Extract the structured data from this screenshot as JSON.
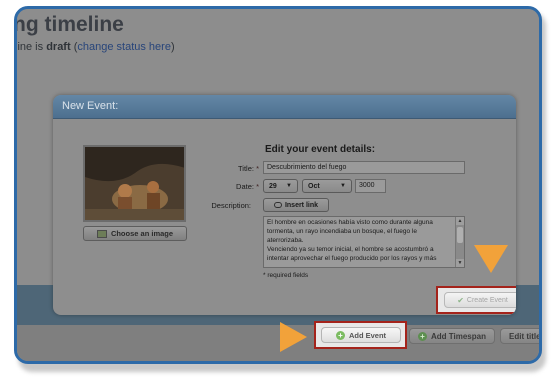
{
  "background": {
    "title": "ng timeline",
    "status_prefix": "line is ",
    "status_value": "draft",
    "status_link": "change status here",
    "toolbar": {
      "add_timespan_label": "Add Timespan",
      "edit_title_label": "Edit title"
    }
  },
  "modal": {
    "title": "New Event:",
    "heading": "Edit your event details:",
    "choose_image_label": "Choose an image",
    "title_label": "Title:",
    "title_value": "Descubrimiento del fuego",
    "date_label": "Date:",
    "day_value": "29",
    "month_value": "Oct",
    "year_value": "3000",
    "description_label": "Description:",
    "insert_link_label": "Insert link",
    "description_lines": [
      "El hombre en ocasiones había visto como durante alguna",
      "tormenta, un rayo incendiaba un bosque, el fuego le",
      "aterrorizaba.",
      "Venciendo ya su temor inicial, el hombre se acostumbró a",
      "intentar aprovechar el fuego producido por los rayos y más"
    ],
    "required_note": "* required fields",
    "required_mark": "*",
    "create_label": "Create Event"
  },
  "add_event_label": "Add Event",
  "colors": {
    "frame": "#2d6aa8",
    "highlight": "#a4231b",
    "arrow": "#f2a23a"
  },
  "icons": [
    "image-icon",
    "link-icon",
    "check-icon",
    "plus-icon",
    "arrow-down-indicator",
    "arrow-right-indicator"
  ]
}
